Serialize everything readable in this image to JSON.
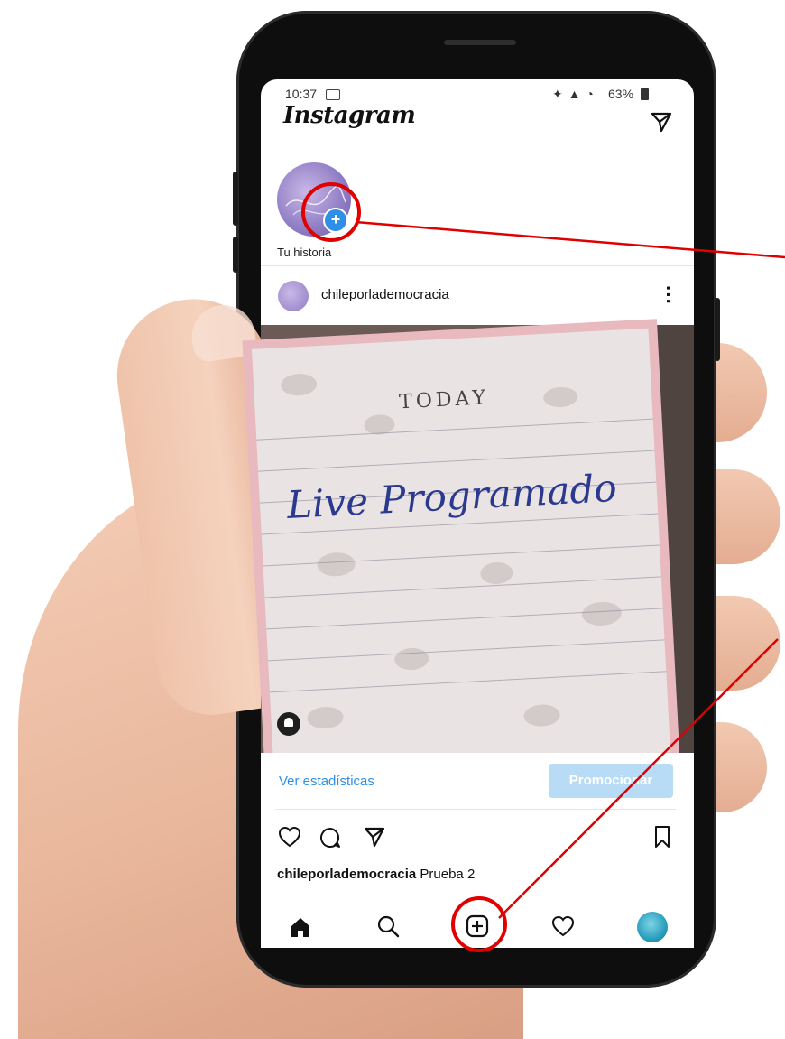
{
  "status_bar": {
    "time": "10:37",
    "battery": "63%"
  },
  "header": {
    "logo": "Instagram"
  },
  "stories": {
    "own_story_label": "Tu historia"
  },
  "post": {
    "username": "chileporlademocracia",
    "image_text_today": "TODAY",
    "image_text_handwritten": "Live Programado",
    "stats_link": "Ver estadísticas",
    "promote_button": "Promocionar",
    "caption_user": "chileporlademocracia",
    "caption_text": "Prueba 2"
  },
  "colors": {
    "accent_blue": "#2f8fe6",
    "promote_button_bg": "#b8dcf6",
    "annotation_red": "#e00000"
  },
  "icons": [
    "camera-icon",
    "direct-message-icon",
    "add-story-icon",
    "more-options-icon",
    "bell-icon",
    "heart-icon",
    "comment-icon",
    "share-icon",
    "bookmark-icon",
    "home-icon",
    "search-icon",
    "new-post-icon",
    "activity-heart-icon",
    "profile-avatar"
  ]
}
